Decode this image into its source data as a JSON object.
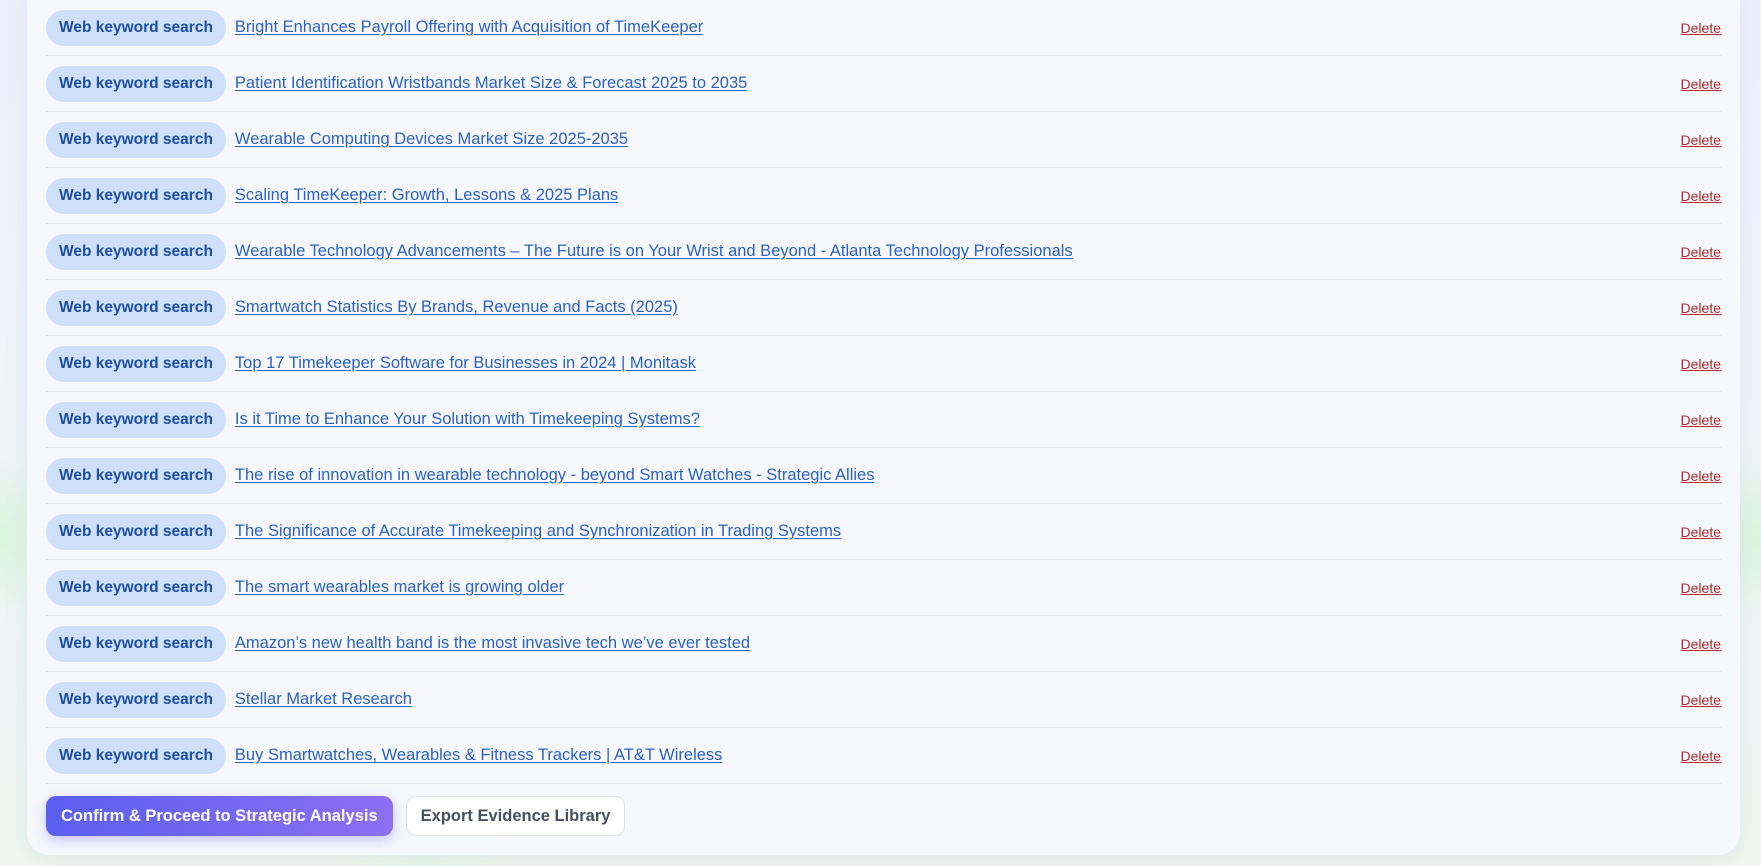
{
  "rows": [
    {
      "badge": "Web keyword search",
      "title": "Bright Enhances Payroll Offering with Acquisition of TimeKeeper",
      "action": "Delete"
    },
    {
      "badge": "Web keyword search",
      "title": "Patient Identification Wristbands Market Size & Forecast 2025 to 2035",
      "action": "Delete"
    },
    {
      "badge": "Web keyword search",
      "title": "Wearable Computing Devices Market Size 2025-2035",
      "action": "Delete"
    },
    {
      "badge": "Web keyword search",
      "title": "Scaling TimeKeeper: Growth, Lessons & 2025 Plans",
      "action": "Delete"
    },
    {
      "badge": "Web keyword search",
      "title": "Wearable Technology Advancements – The Future is on Your Wrist and Beyond - Atlanta Technology Professionals",
      "action": "Delete"
    },
    {
      "badge": "Web keyword search",
      "title": "Smartwatch Statistics By Brands, Revenue and Facts (2025)",
      "action": "Delete"
    },
    {
      "badge": "Web keyword search",
      "title": "Top 17 Timekeeper Software for Businesses in 2024 | Monitask",
      "action": "Delete"
    },
    {
      "badge": "Web keyword search",
      "title": "Is it Time to Enhance Your Solution with Timekeeping Systems?",
      "action": "Delete"
    },
    {
      "badge": "Web keyword search",
      "title": "The rise of innovation in wearable technology - beyond Smart Watches - Strategic Allies",
      "action": "Delete"
    },
    {
      "badge": "Web keyword search",
      "title": "The Significance of Accurate Timekeeping and Synchronization in Trading Systems",
      "action": "Delete"
    },
    {
      "badge": "Web keyword search",
      "title": "The smart wearables market is growing older",
      "action": "Delete"
    },
    {
      "badge": "Web keyword search",
      "title": "Amazon’s new health band is the most invasive tech we’ve ever tested",
      "action": "Delete"
    },
    {
      "badge": "Web keyword search",
      "title": "Stellar Market Research",
      "action": "Delete"
    },
    {
      "badge": "Web keyword search",
      "title": "Buy Smartwatches, Wearables & Fitness Trackers | AT&T Wireless",
      "action": "Delete"
    }
  ],
  "actions": {
    "confirm_label": "Confirm & Proceed to Strategic Analysis",
    "export_label": "Export Evidence Library"
  },
  "colors": {
    "badge_bg": "#cfe0fb",
    "badge_text": "#1d4fa6",
    "link": "#2a62c9",
    "delete": "#b02a2a",
    "primary_start": "#5b5ef0",
    "primary_end": "#8d6ff3"
  }
}
